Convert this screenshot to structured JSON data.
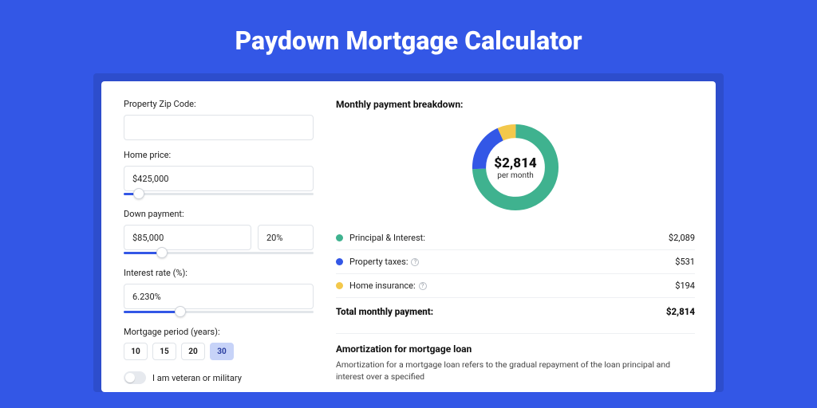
{
  "title": "Paydown Mortgage Calculator",
  "colors": {
    "accent": "#3357e6",
    "green": "#3fb28f",
    "blue": "#3357e6",
    "yellow": "#f3c84b"
  },
  "left": {
    "zip": {
      "label": "Property Zip Code:",
      "value": ""
    },
    "home_price": {
      "label": "Home price:",
      "value": "$425,000",
      "slider_pct": 8
    },
    "down_payment": {
      "label": "Down payment:",
      "amount": "$85,000",
      "pct": "20%",
      "slider_pct": 20
    },
    "interest": {
      "label": "Interest rate (%):",
      "value": "6.230%",
      "slider_pct": 30
    },
    "period": {
      "label": "Mortgage period (years):",
      "options": [
        "10",
        "15",
        "20",
        "30"
      ],
      "active": "30"
    },
    "veteran": {
      "label": "I am veteran or military",
      "on": false
    }
  },
  "right": {
    "breakdown_title": "Monthly payment breakdown:",
    "center_amount": "$2,814",
    "center_period": "per month",
    "items": [
      {
        "name": "Principal & Interest:",
        "value": "$2,089",
        "color": "#3fb28f",
        "info": false
      },
      {
        "name": "Property taxes:",
        "value": "$531",
        "color": "#3357e6",
        "info": true
      },
      {
        "name": "Home insurance:",
        "value": "$194",
        "color": "#f3c84b",
        "info": true
      }
    ],
    "total": {
      "label": "Total monthly payment:",
      "value": "$2,814"
    },
    "amort": {
      "title": "Amortization for mortgage loan",
      "text": "Amortization for a mortgage loan refers to the gradual repayment of the loan principal and interest over a specified"
    }
  },
  "chart_data": {
    "type": "pie",
    "title": "Monthly payment breakdown",
    "series": [
      {
        "name": "Principal & Interest",
        "value": 2089,
        "color": "#3fb28f"
      },
      {
        "name": "Property taxes",
        "value": 531,
        "color": "#3357e6"
      },
      {
        "name": "Home insurance",
        "value": 194,
        "color": "#f3c84b"
      }
    ],
    "total": 2814
  }
}
